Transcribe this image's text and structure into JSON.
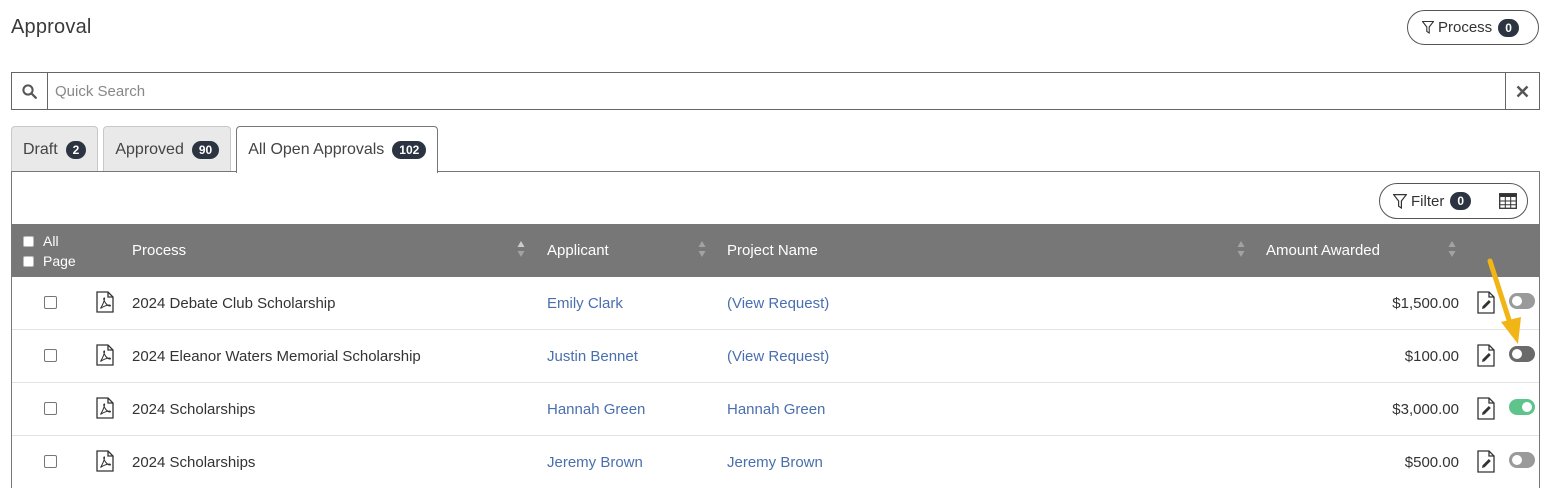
{
  "page": {
    "title": "Approval"
  },
  "process_button": {
    "label": "Process",
    "count": "0"
  },
  "search": {
    "placeholder": "Quick Search"
  },
  "tabs": [
    {
      "label": "Draft",
      "count": "2",
      "active": false
    },
    {
      "label": "Approved",
      "count": "90",
      "active": false
    },
    {
      "label": "All Open Approvals",
      "count": "102",
      "active": true
    }
  ],
  "filter_button": {
    "label": "Filter",
    "count": "0"
  },
  "table": {
    "select": {
      "all": "All",
      "page": "Page"
    },
    "columns": {
      "process": "Process",
      "applicant": "Applicant",
      "project_name": "Project Name",
      "amount_awarded": "Amount Awarded"
    },
    "rows": [
      {
        "process": "2024 Debate Club Scholarship",
        "applicant": "Emily Clark",
        "project": "(View Request)",
        "amount": "$1,500.00",
        "enabled": false
      },
      {
        "process": "2024 Eleanor Waters Memorial Scholarship",
        "applicant": "Justin Bennet",
        "project": "(View Request)",
        "amount": "$100.00",
        "enabled": false
      },
      {
        "process": "2024 Scholarships",
        "applicant": "Hannah Green",
        "project": "Hannah Green",
        "amount": "$3,000.00",
        "enabled": true
      },
      {
        "process": "2024 Scholarships",
        "applicant": "Jeremy Brown",
        "project": "Jeremy Brown",
        "amount": "$500.00",
        "enabled": false
      }
    ]
  },
  "colors": {
    "header_bg": "#777777",
    "badge_bg": "#2b3440",
    "link": "#4a6fae",
    "toggle_on": "#5ec48c",
    "toggle_off": "#9a9a9a",
    "annotation_arrow": "#f2b516"
  }
}
